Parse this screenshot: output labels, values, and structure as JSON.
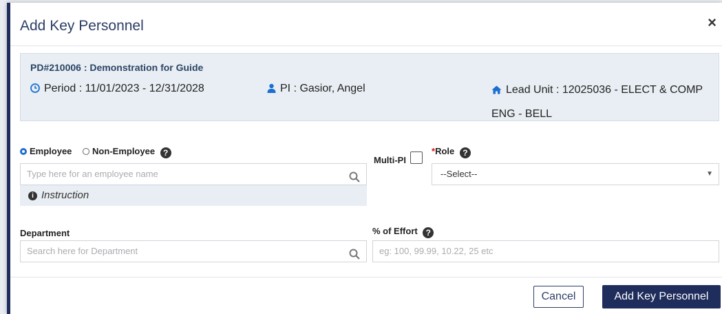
{
  "modal": {
    "title": "Add Key Personnel",
    "close_label": "×"
  },
  "info": {
    "proposal": "PD#210006 : Demonstration for Guide",
    "period": "Period : 11/01/2023 - 12/31/2028",
    "pi": "PI : Gasior, Angel",
    "lead_unit": "Lead Unit : 12025036 - ELECT & COMP ENG - BELL"
  },
  "form": {
    "employee_label": "Employee",
    "non_employee_label": "Non-Employee",
    "employee_selected": true,
    "employee_search_placeholder": "Type here for an employee name",
    "instruction": "Instruction",
    "multi_pi_label": "Multi-PI",
    "multi_pi_checked": false,
    "role_label": "Role",
    "role_required_mark": "*",
    "role_value": "--Select--",
    "department_label": "Department",
    "department_placeholder": "Search here for Department",
    "effort_label": "% of Effort",
    "effort_placeholder": "eg: 100, 99.99, 10.22, 25 etc"
  },
  "buttons": {
    "cancel": "Cancel",
    "add": "Add Key Personnel"
  },
  "colors": {
    "primary": "#1f2d5c",
    "accent_blue": "#1c6fd1",
    "card_bg": "#e8eef3",
    "required": "#dd1111"
  }
}
